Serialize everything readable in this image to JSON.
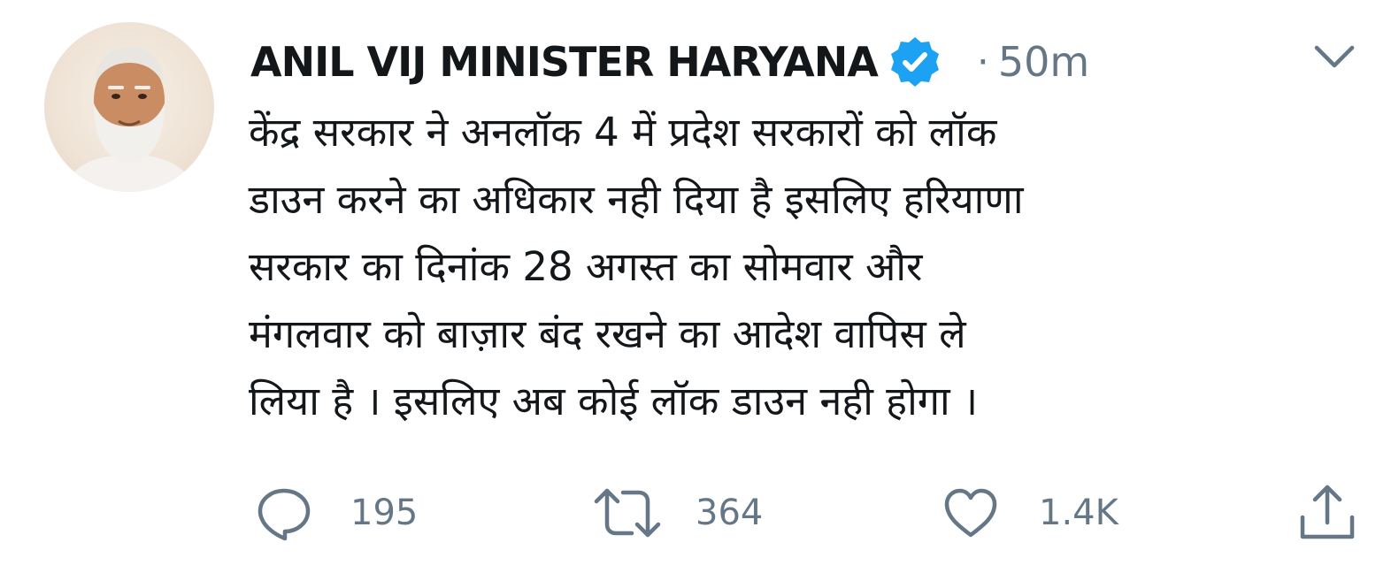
{
  "author": {
    "display_name": "ANIL VIJ MINISTER HARYANA",
    "verified": true,
    "separator": "·",
    "time_ago": "50m"
  },
  "icons": {
    "avatar": "profile-photo",
    "verified": "verified-badge-icon",
    "caret": "chevron-down-icon",
    "reply": "reply-icon",
    "retweet": "retweet-icon",
    "like": "heart-icon",
    "share": "share-icon"
  },
  "colors": {
    "text": "#14171a",
    "secondary": "#657786",
    "verified": "#1da1f2"
  },
  "tweet": {
    "lines": [
      "केंद्र सरकार ने अनलॉक 4 में प्रदेश सरकारों को लॉक",
      "डाउन करने का अधिकार नही दिया है इसलिए हरियाणा",
      "सरकार का दिनांक 28 अगस्त का सोमवार और",
      "मंगलवार को बाज़ार बंद रखने का आदेश वापिस ले",
      "लिया है । इसलिए अब कोई लॉक डाउन नही होगा ।"
    ]
  },
  "actions": {
    "replies": "195",
    "retweets": "364",
    "likes": "1.4K"
  }
}
